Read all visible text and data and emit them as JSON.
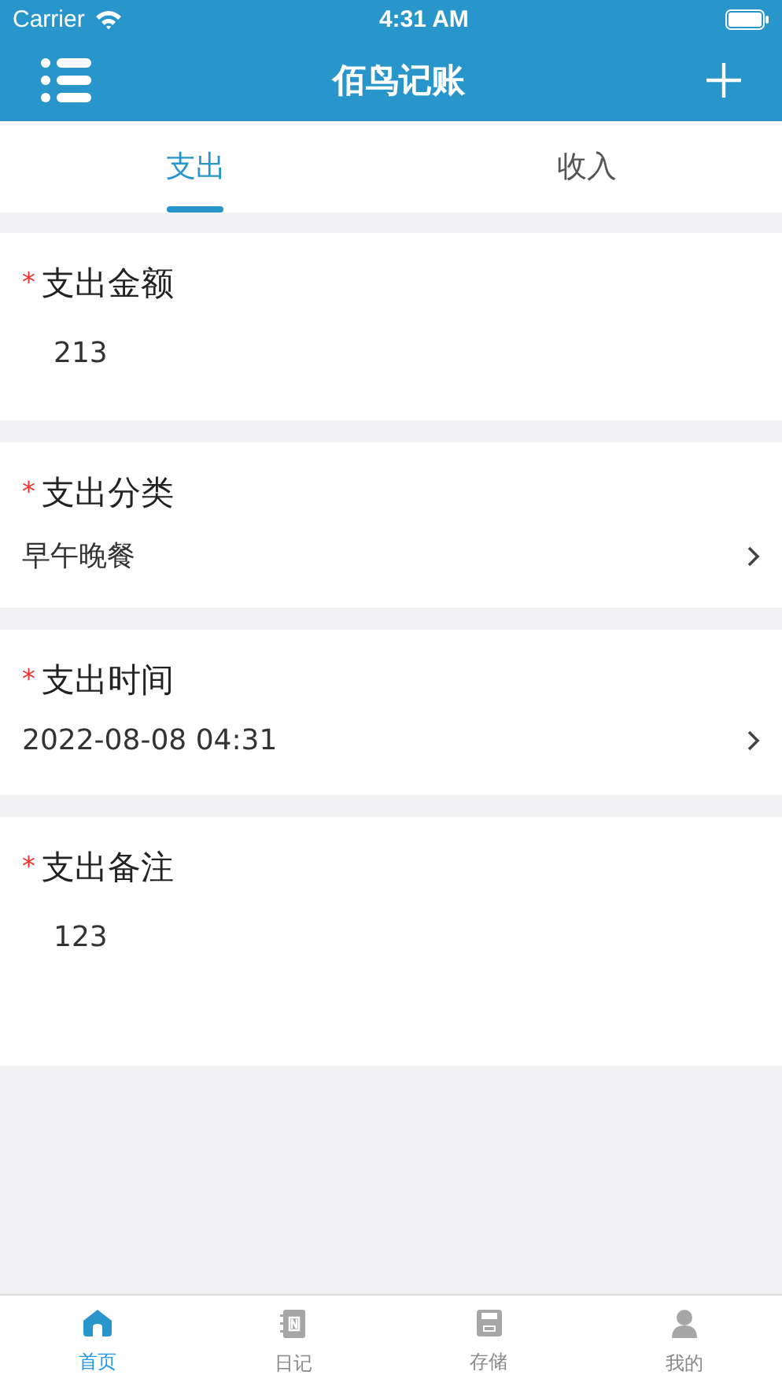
{
  "status_bar": {
    "carrier": "Carrier",
    "time": "4:31 AM"
  },
  "nav": {
    "title": "佰鸟记账"
  },
  "tabs": [
    {
      "label": "支出",
      "selected": true
    },
    {
      "label": "收入",
      "selected": false
    }
  ],
  "fields": [
    {
      "kind": "input",
      "asterisk": "*",
      "label": "支出金额",
      "value": "213"
    },
    {
      "kind": "picker",
      "asterisk": "*",
      "label": "支出分类",
      "value": "早午晚餐"
    },
    {
      "kind": "picker",
      "asterisk": "*",
      "label": "支出时间",
      "value": "2022-08-08 04:31"
    },
    {
      "kind": "textarea",
      "asterisk": "*",
      "label": "支出备注",
      "value": "123"
    }
  ],
  "tab_bar": [
    {
      "kind": "home",
      "label": "首页",
      "selected": true
    },
    {
      "kind": "notebook",
      "label": "日记",
      "selected": false
    },
    {
      "kind": "disk",
      "label": "存储",
      "selected": false
    },
    {
      "kind": "person",
      "label": "我的",
      "selected": false
    }
  ]
}
